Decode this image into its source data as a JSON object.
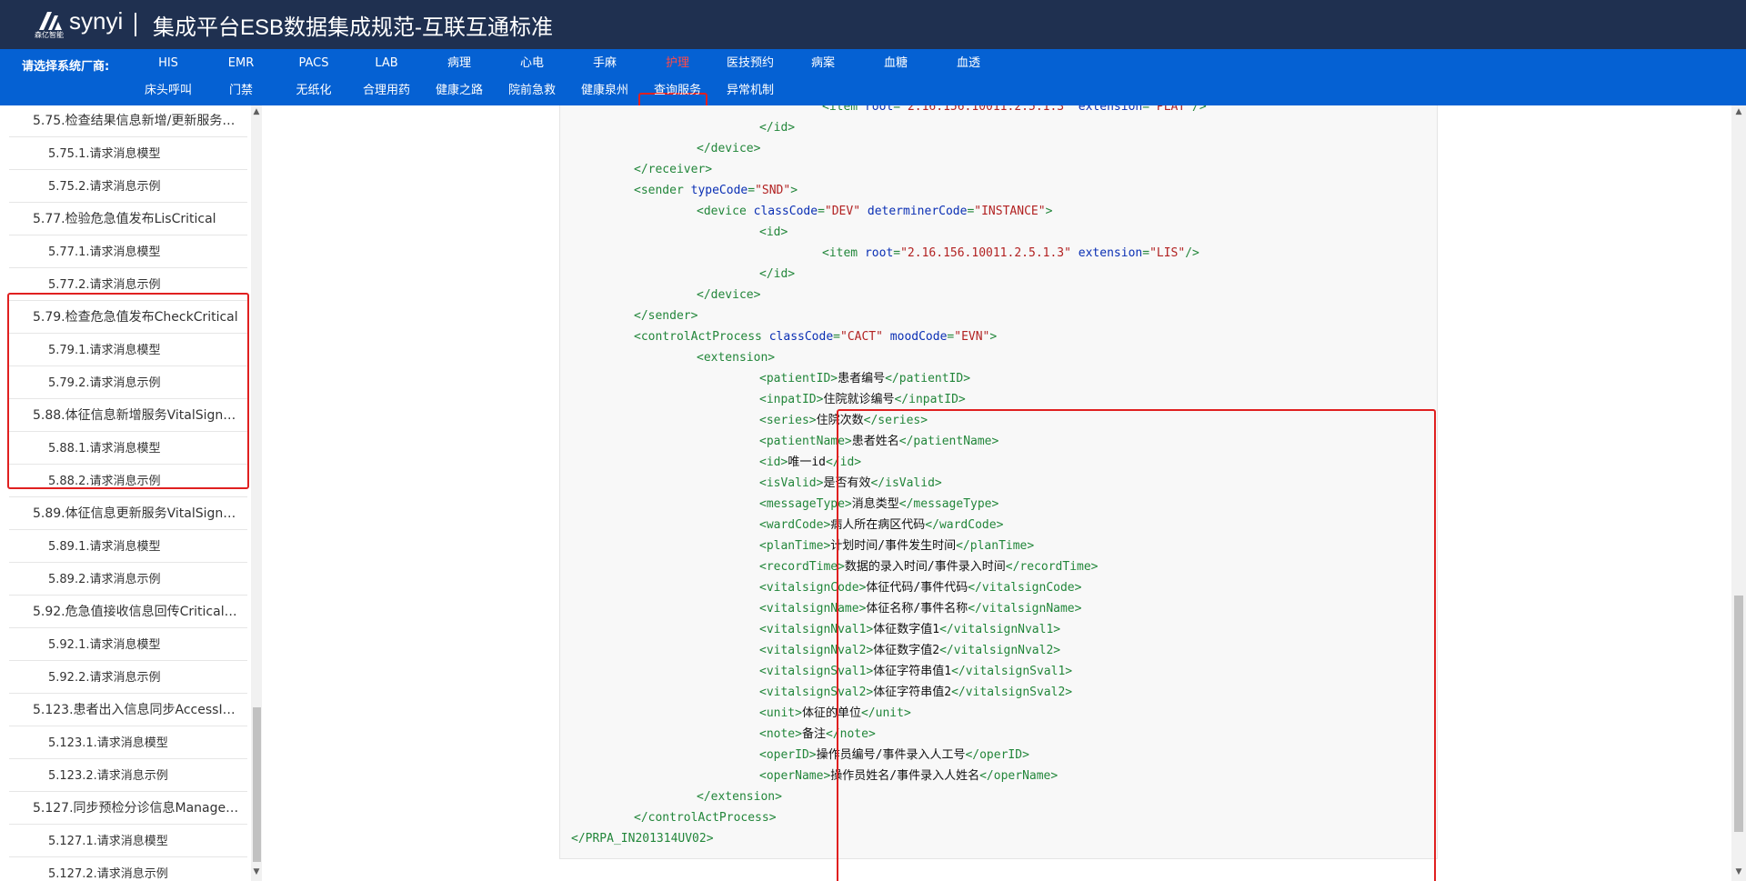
{
  "header": {
    "logo_text": "synyi",
    "logo_sub": "森亿智能",
    "title": "集成平台ESB数据集成规范-互联互通标准"
  },
  "vendors": {
    "label": "请选择系统厂商:",
    "row1": [
      "HIS",
      "EMR",
      "PACS",
      "LAB",
      "病理",
      "心电",
      "手麻",
      "护理",
      "医技预约",
      "病案",
      "血糖",
      "血透"
    ],
    "row2": [
      "床头呼叫",
      "门禁",
      "无纸化",
      "合理用药",
      "健康之路",
      "院前急救",
      "健康泉州",
      "查询服务",
      "异常机制"
    ],
    "active": "护理"
  },
  "sidebar": {
    "items": [
      {
        "label": "5.75.检查结果信息新增/更新服务…",
        "level": 1
      },
      {
        "label": "5.75.1.请求消息模型",
        "level": 2
      },
      {
        "label": "5.75.2.请求消息示例",
        "level": 2
      },
      {
        "label": "5.77.检验危急值发布LisCritical",
        "level": 1
      },
      {
        "label": "5.77.1.请求消息模型",
        "level": 2
      },
      {
        "label": "5.77.2.请求消息示例",
        "level": 2
      },
      {
        "label": "5.79.检查危急值发布CheckCritical",
        "level": 1
      },
      {
        "label": "5.79.1.请求消息模型",
        "level": 2
      },
      {
        "label": "5.79.2.请求消息示例",
        "level": 2
      },
      {
        "label": "5.88.体征信息新增服务VitalSign…",
        "level": 1
      },
      {
        "label": "5.88.1.请求消息模型",
        "level": 2
      },
      {
        "label": "5.88.2.请求消息示例",
        "level": 2
      },
      {
        "label": "5.89.体征信息更新服务VitalSign…",
        "level": 1
      },
      {
        "label": "5.89.1.请求消息模型",
        "level": 2
      },
      {
        "label": "5.89.2.请求消息示例",
        "level": 2
      },
      {
        "label": "5.92.危急值接收信息回传Critical…",
        "level": 1
      },
      {
        "label": "5.92.1.请求消息模型",
        "level": 2
      },
      {
        "label": "5.92.2.请求消息示例",
        "level": 2
      },
      {
        "label": "5.123.患者出入信息同步AccessI…",
        "level": 1
      },
      {
        "label": "5.123.1.请求消息模型",
        "level": 2
      },
      {
        "label": "5.123.2.请求消息示例",
        "level": 2
      },
      {
        "label": "5.127.同步预检分诊信息Manage…",
        "level": 1
      },
      {
        "label": "5.127.1.请求消息模型",
        "level": 2
      },
      {
        "label": "5.127.2.请求消息示例",
        "level": 2
      }
    ]
  },
  "code": {
    "lines": [
      {
        "indent": 4,
        "parts": [
          [
            "t",
            "<item "
          ],
          [
            "a",
            "root"
          ],
          [
            "t",
            "="
          ],
          [
            "v",
            "\"2.16.156.10011.2.5.1.3\""
          ],
          [
            "t",
            " "
          ],
          [
            "a",
            "extension"
          ],
          [
            "t",
            "="
          ],
          [
            "v",
            "\"PLAT\""
          ],
          [
            "t",
            "/>"
          ]
        ]
      },
      {
        "indent": 3,
        "parts": [
          [
            "t",
            "</id>"
          ]
        ]
      },
      {
        "indent": 2,
        "parts": [
          [
            "t",
            "</device>"
          ]
        ]
      },
      {
        "indent": 1,
        "parts": [
          [
            "t",
            "</receiver>"
          ]
        ]
      },
      {
        "indent": 1,
        "parts": [
          [
            "t",
            "<sender "
          ],
          [
            "a",
            "typeCode"
          ],
          [
            "t",
            "="
          ],
          [
            "v",
            "\"SND\""
          ],
          [
            "t",
            ">"
          ]
        ]
      },
      {
        "indent": 2,
        "parts": [
          [
            "t",
            "<device "
          ],
          [
            "a",
            "classCode"
          ],
          [
            "t",
            "="
          ],
          [
            "v",
            "\"DEV\""
          ],
          [
            "t",
            " "
          ],
          [
            "a",
            "determinerCode"
          ],
          [
            "t",
            "="
          ],
          [
            "v",
            "\"INSTANCE\""
          ],
          [
            "t",
            ">"
          ]
        ]
      },
      {
        "indent": 3,
        "parts": [
          [
            "t",
            "<id>"
          ]
        ]
      },
      {
        "indent": 4,
        "parts": [
          [
            "t",
            "<item "
          ],
          [
            "a",
            "root"
          ],
          [
            "t",
            "="
          ],
          [
            "v",
            "\"2.16.156.10011.2.5.1.3\""
          ],
          [
            "t",
            " "
          ],
          [
            "a",
            "extension"
          ],
          [
            "t",
            "="
          ],
          [
            "v",
            "\"LIS\""
          ],
          [
            "t",
            "/>"
          ]
        ]
      },
      {
        "indent": 3,
        "parts": [
          [
            "t",
            "</id>"
          ]
        ]
      },
      {
        "indent": 2,
        "parts": [
          [
            "t",
            "</device>"
          ]
        ]
      },
      {
        "indent": 1,
        "parts": [
          [
            "t",
            "</sender>"
          ]
        ]
      },
      {
        "indent": 1,
        "parts": [
          [
            "t",
            "<controlActProcess "
          ],
          [
            "a",
            "classCode"
          ],
          [
            "t",
            "="
          ],
          [
            "v",
            "\"CACT\""
          ],
          [
            "t",
            " "
          ],
          [
            "a",
            "moodCode"
          ],
          [
            "t",
            "="
          ],
          [
            "v",
            "\"EVN\""
          ],
          [
            "t",
            ">"
          ]
        ]
      },
      {
        "indent": 2,
        "parts": [
          [
            "t",
            "<extension>"
          ]
        ]
      },
      {
        "indent": 3,
        "parts": [
          [
            "t",
            "<patientID>"
          ],
          [
            "x",
            "患者编号"
          ],
          [
            "t",
            "</patientID>"
          ]
        ]
      },
      {
        "indent": 3,
        "parts": [
          [
            "t",
            "<inpatID>"
          ],
          [
            "x",
            "住院就诊编号"
          ],
          [
            "t",
            "</inpatID>"
          ]
        ]
      },
      {
        "indent": 3,
        "parts": [
          [
            "t",
            "<series>"
          ],
          [
            "x",
            "住院次数"
          ],
          [
            "t",
            "</series>"
          ]
        ]
      },
      {
        "indent": 3,
        "parts": [
          [
            "t",
            "<patientName>"
          ],
          [
            "x",
            "患者姓名"
          ],
          [
            "t",
            "</patientName>"
          ]
        ]
      },
      {
        "indent": 3,
        "parts": [
          [
            "t",
            "<id>"
          ],
          [
            "x",
            "唯一id"
          ],
          [
            "t",
            "</id>"
          ]
        ]
      },
      {
        "indent": 3,
        "parts": [
          [
            "t",
            "<isValid>"
          ],
          [
            "x",
            "是否有效"
          ],
          [
            "t",
            "</isValid>"
          ]
        ]
      },
      {
        "indent": 3,
        "parts": [
          [
            "t",
            "<messageType>"
          ],
          [
            "x",
            "消息类型"
          ],
          [
            "t",
            "</messageType>"
          ]
        ]
      },
      {
        "indent": 3,
        "parts": [
          [
            "t",
            "<wardCode>"
          ],
          [
            "x",
            "病人所在病区代码"
          ],
          [
            "t",
            "</wardCode>"
          ]
        ]
      },
      {
        "indent": 3,
        "parts": [
          [
            "t",
            "<planTime>"
          ],
          [
            "x",
            "计划时间/事件发生时间"
          ],
          [
            "t",
            "</planTime>"
          ]
        ]
      },
      {
        "indent": 3,
        "parts": [
          [
            "t",
            "<recordTime>"
          ],
          [
            "x",
            "数据的录入时间/事件录入时间"
          ],
          [
            "t",
            "</recordTime>"
          ]
        ]
      },
      {
        "indent": 3,
        "parts": [
          [
            "t",
            "<vitalsignCode>"
          ],
          [
            "x",
            "体征代码/事件代码"
          ],
          [
            "t",
            "</vitalsignCode>"
          ]
        ]
      },
      {
        "indent": 3,
        "parts": [
          [
            "t",
            "<vitalsignName>"
          ],
          [
            "x",
            "体征名称/事件名称"
          ],
          [
            "t",
            "</vitalsignName>"
          ]
        ]
      },
      {
        "indent": 3,
        "parts": [
          [
            "t",
            "<vitalsignNval1>"
          ],
          [
            "x",
            "体征数字值1"
          ],
          [
            "t",
            "</vitalsignNval1>"
          ]
        ]
      },
      {
        "indent": 3,
        "parts": [
          [
            "t",
            "<vitalsignNval2>"
          ],
          [
            "x",
            "体征数字值2"
          ],
          [
            "t",
            "</vitalsignNval2>"
          ]
        ]
      },
      {
        "indent": 3,
        "parts": [
          [
            "t",
            "<vitalsignSval1>"
          ],
          [
            "x",
            "体征字符串值1"
          ],
          [
            "t",
            "</vitalsignSval1>"
          ]
        ]
      },
      {
        "indent": 3,
        "parts": [
          [
            "t",
            "<vitalsignSval2>"
          ],
          [
            "x",
            "体征字符串值2"
          ],
          [
            "t",
            "</vitalsignSval2>"
          ]
        ]
      },
      {
        "indent": 3,
        "parts": [
          [
            "t",
            "<unit>"
          ],
          [
            "x",
            "体征的单位"
          ],
          [
            "t",
            "</unit>"
          ]
        ]
      },
      {
        "indent": 3,
        "parts": [
          [
            "t",
            "<note>"
          ],
          [
            "x",
            "备注"
          ],
          [
            "t",
            "</note>"
          ]
        ]
      },
      {
        "indent": 3,
        "parts": [
          [
            "t",
            "<operID>"
          ],
          [
            "x",
            "操作员编号/事件录入人工号"
          ],
          [
            "t",
            "</operID>"
          ]
        ]
      },
      {
        "indent": 3,
        "parts": [
          [
            "t",
            "<operName>"
          ],
          [
            "x",
            "操作员姓名/事件录入人姓名"
          ],
          [
            "t",
            "</operName>"
          ]
        ]
      },
      {
        "indent": 2,
        "parts": [
          [
            "t",
            "</extension>"
          ]
        ]
      },
      {
        "indent": 1,
        "parts": [
          [
            "t",
            "</controlActProcess>"
          ]
        ]
      },
      {
        "indent": 0,
        "parts": [
          [
            "t",
            "</PRPA_IN201314UV02>"
          ]
        ]
      }
    ]
  },
  "colors": {
    "header_bg": "#1f3050",
    "nav_bg": "#0561d3",
    "highlight": "#e02020",
    "tag": "#22863a",
    "attr": "#0a2fb4",
    "value": "#b22222"
  }
}
